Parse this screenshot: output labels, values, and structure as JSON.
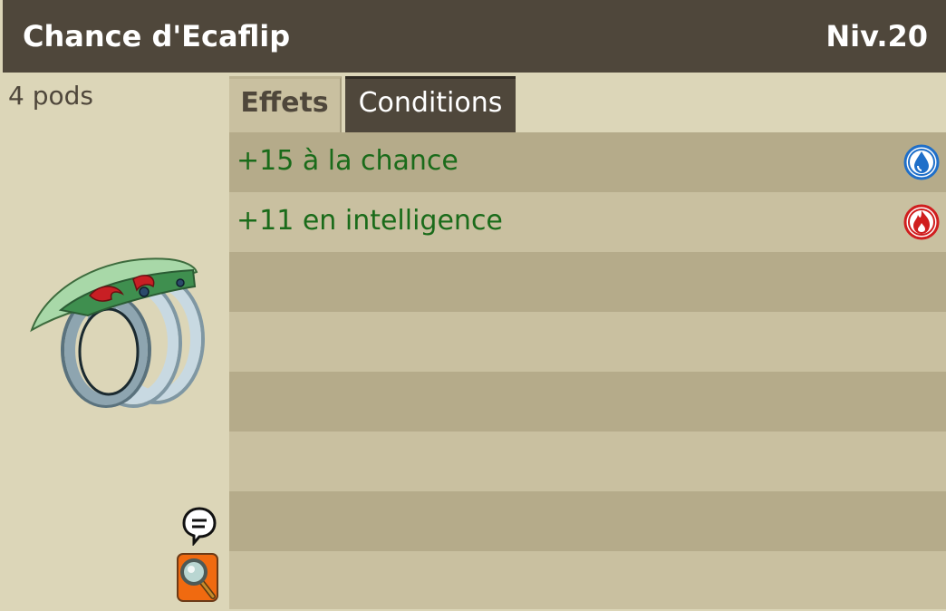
{
  "header": {
    "item_name": "Chance d'Ecaflip",
    "level": "Niv.20"
  },
  "left": {
    "weight": "4 pods",
    "item_image_icon": "ring-item-icon",
    "chat_icon": "chat-bubble-icon",
    "search_icon": "magnifier-icon"
  },
  "tabs": [
    {
      "label": "Effets",
      "active": true
    },
    {
      "label": "Conditions",
      "active": false
    }
  ],
  "effects": [
    {
      "text": "+15 à la chance",
      "element_icon": "water-drop-icon",
      "element_color": "#1f6fc9"
    },
    {
      "text": "+11 en intelligence",
      "element_icon": "fire-icon",
      "element_color": "#d01e1e"
    }
  ],
  "colors": {
    "header_bg": "#4f473b",
    "panel_bg": "#dcd6b8",
    "row_dark": "#b5ab8a",
    "row_light": "#c9c0a0",
    "effect_text": "#1a6b1a",
    "search_button": "#f06a10"
  }
}
